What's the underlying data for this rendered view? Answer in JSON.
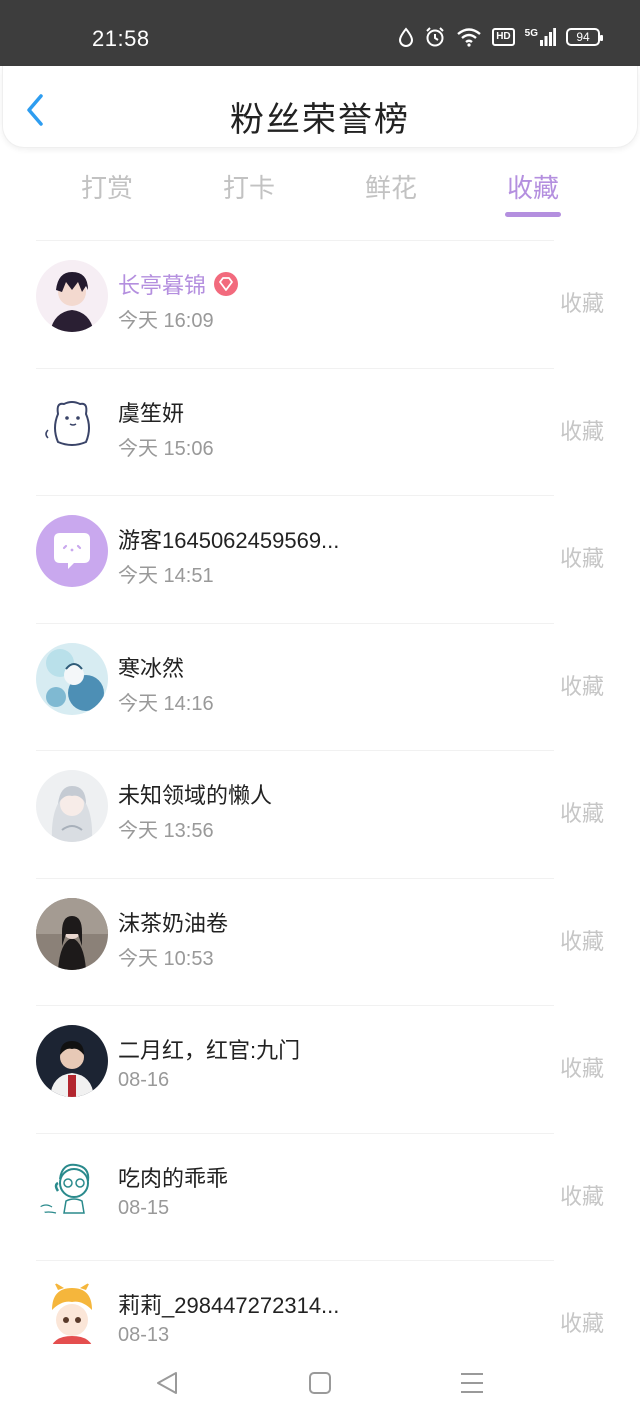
{
  "status_bar": {
    "time": "21:58",
    "icons": [
      "water-drop-icon",
      "alarm-icon",
      "wifi-icon",
      "hd-icon",
      "signal-5g-icon",
      "battery-icon"
    ],
    "hd": "HD",
    "network": "5G",
    "battery": "94"
  },
  "header": {
    "title": "粉丝荣誉榜",
    "back_icon": "chevron-left-icon"
  },
  "tabs": [
    {
      "label": "打赏",
      "active": false
    },
    {
      "label": "打卡",
      "active": false
    },
    {
      "label": "鲜花",
      "active": false
    },
    {
      "label": "收藏",
      "active": true
    }
  ],
  "colors": {
    "accent": "#b48fdf",
    "back": "#2e9df0",
    "muted": "#c2c2c2"
  },
  "fans": [
    {
      "name": "长亭暮锦",
      "time": "今天 16:09",
      "action": "收藏",
      "vip": true
    },
    {
      "name": "虞笙妍",
      "time": "今天 15:06",
      "action": "收藏",
      "vip": false
    },
    {
      "name": "游客1645062459569...",
      "time": "今天 14:51",
      "action": "收藏",
      "vip": false
    },
    {
      "name": "寒冰然",
      "time": "今天 14:16",
      "action": "收藏",
      "vip": false
    },
    {
      "name": "未知领域的懒人",
      "time": "今天 13:56",
      "action": "收藏",
      "vip": false
    },
    {
      "name": "沫茶奶油卷",
      "time": "今天 10:53",
      "action": "收藏",
      "vip": false
    },
    {
      "name": "二月红，红官:九门",
      "time": "08-16",
      "action": "收藏",
      "vip": false
    },
    {
      "name": "吃肉的乖乖",
      "time": "08-15",
      "action": "收藏",
      "vip": false
    },
    {
      "name": "莉莉_298447272314...",
      "time": "08-13",
      "action": "收藏",
      "vip": false
    }
  ],
  "nav_bar": [
    "back-triangle-icon",
    "home-square-icon",
    "menu-lines-icon"
  ]
}
